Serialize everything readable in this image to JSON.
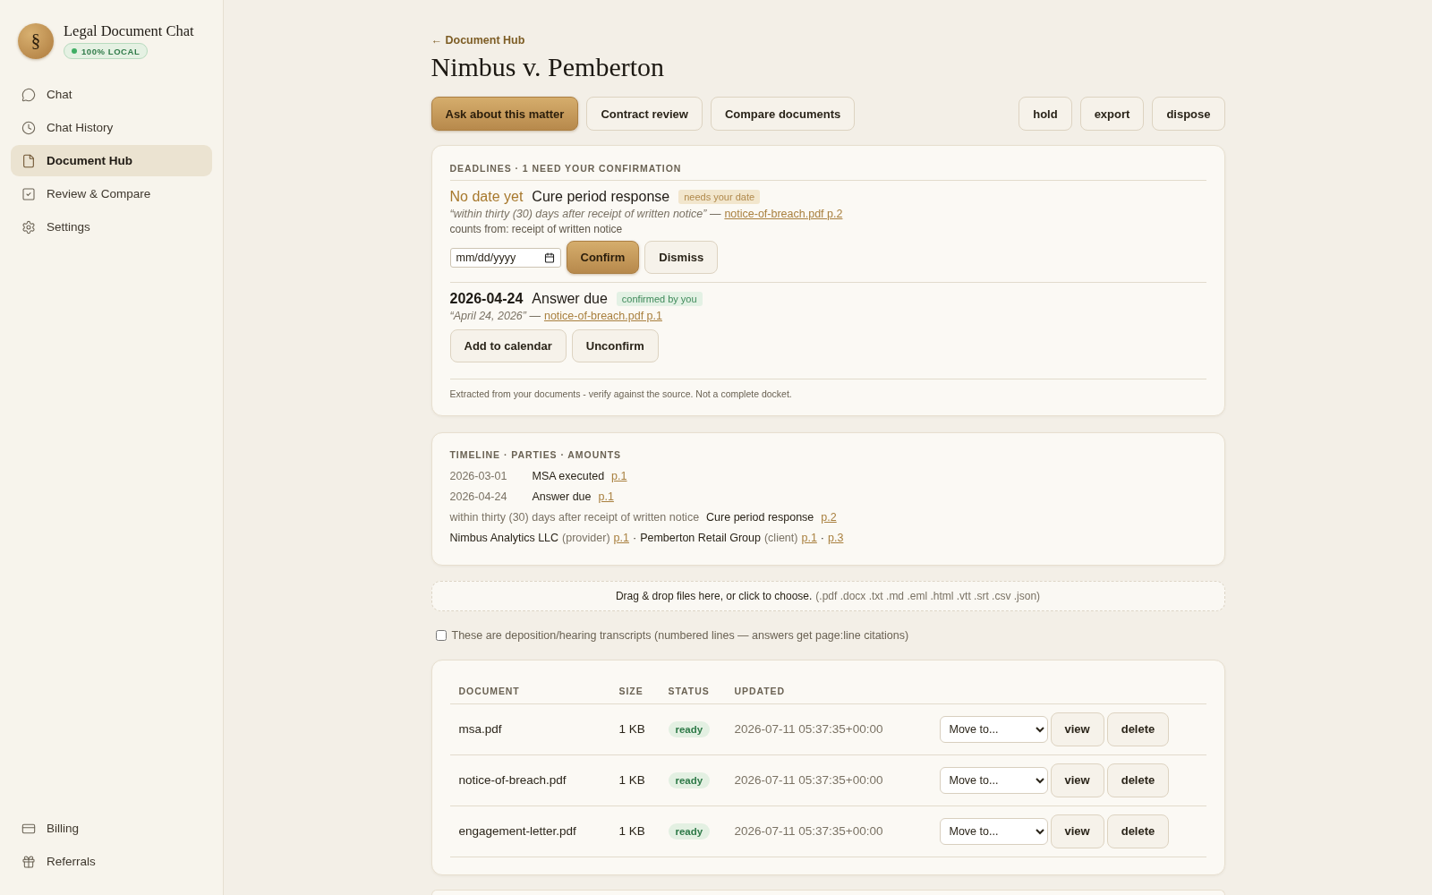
{
  "sidebar": {
    "logo_mark": "§",
    "app_title": "Legal Document Chat",
    "status_badge": "100% LOCAL",
    "nav_items": [
      {
        "label": "Chat",
        "selected": false
      },
      {
        "label": "Chat History",
        "selected": false
      },
      {
        "label": "Document Hub",
        "selected": true
      },
      {
        "label": "Review & Compare",
        "selected": false
      },
      {
        "label": "Settings",
        "selected": false
      }
    ],
    "footer_items": [
      {
        "label": "Billing",
        "selected": false
      },
      {
        "label": "Referrals",
        "selected": false
      }
    ]
  },
  "header": {
    "back_link": "← Document Hub",
    "title": "Nimbus v. Pemberton"
  },
  "actions": [
    {
      "label": "Ask about this matter",
      "kind": "primary"
    },
    {
      "label": "Contract review",
      "kind": "secondary"
    },
    {
      "label": "Compare documents",
      "kind": "secondary"
    }
  ],
  "matter_actions": [
    "hold",
    "export",
    "dispose"
  ],
  "deadlines": {
    "heading": "DEADLINES · 1 NEED YOUR CONFIRMATION",
    "items": [
      {
        "kind": "pending",
        "date": "No date yet",
        "title": "Cure period response",
        "badge": "needs your date",
        "quote": "“within thirty (30) days after receipt of written notice” —",
        "source_link": "notice-of-breach.pdf p.2",
        "counts_from": "counts from: receipt of written notice",
        "date_field": {
          "placeholder": "mm/dd/yyyy"
        },
        "buttons": [
          {
            "label": "Confirm",
            "kind": "primary"
          },
          {
            "label": "Dismiss",
            "kind": "secondary"
          }
        ]
      },
      {
        "kind": "confirmed",
        "date": "2026-04-24",
        "title": "Answer due",
        "badge": "confirmed by you",
        "quote": "“April 24, 2026” —",
        "source_link": "notice-of-breach.pdf p.1",
        "buttons": [
          {
            "label": "Add to calendar",
            "kind": "secondary"
          },
          {
            "label": "Unconfirm",
            "kind": "secondary"
          }
        ]
      }
    ],
    "note": "Extracted from your documents - verify against the source. Not a complete docket."
  },
  "timeline": {
    "heading": "TIMELINE · PARTIES · AMOUNTS",
    "events": [
      {
        "when": "2026-03-01",
        "what": "MSA executed",
        "cites": [
          "p.1"
        ]
      },
      {
        "when": "2026-04-24",
        "what": "Answer due",
        "cites": [
          "p.1"
        ]
      },
      {
        "when": "within thirty (30) days after receipt of written notice",
        "what": "Cure period response",
        "cites": [
          "p.2"
        ]
      }
    ],
    "parties": {
      "separator": "·",
      "items": [
        {
          "name": "Nimbus Analytics LLC",
          "role": "(provider)",
          "cites": [
            "p.1"
          ]
        },
        {
          "name": "Pemberton Retail Group",
          "role": "(client)",
          "cites": [
            "p.1",
            "p.3"
          ]
        }
      ]
    }
  },
  "dropzone": {
    "text": "Drag & drop files here, or click to choose.",
    "formats": "(.pdf .docx .txt .md .eml .html .vtt .srt .csv .json)"
  },
  "transcript_option": {
    "label": "These are deposition/hearing transcripts (numbered lines — answers get page:line citations)",
    "checked": false
  },
  "documents": {
    "columns": [
      "DOCUMENT",
      "SIZE",
      "STATUS",
      "UPDATED"
    ],
    "rows": [
      {
        "name": "msa.pdf",
        "size": "1 KB",
        "status": "ready",
        "updated": "2026-07-11 05:37:35+00:00",
        "move_select": "Move to...",
        "actions": [
          "view",
          "delete"
        ]
      },
      {
        "name": "notice-of-breach.pdf",
        "size": "1 KB",
        "status": "ready",
        "updated": "2026-07-11 05:37:35+00:00",
        "move_select": "Move to...",
        "actions": [
          "view",
          "delete"
        ]
      },
      {
        "name": "engagement-letter.pdf",
        "size": "1 KB",
        "status": "ready",
        "updated": "2026-07-11 05:37:35+00:00",
        "move_select": "Move to...",
        "actions": [
          "view",
          "delete"
        ]
      }
    ]
  }
}
